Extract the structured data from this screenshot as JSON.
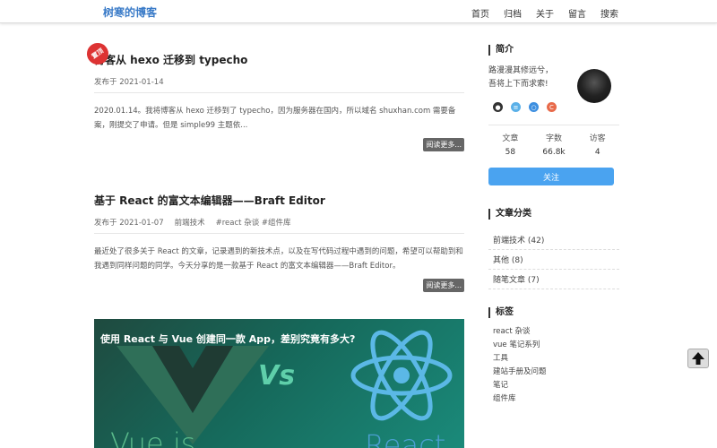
{
  "header": {
    "site_title": "树寒的博客",
    "nav": [
      "首页",
      "归档",
      "关于",
      "留言",
      "搜索"
    ]
  },
  "posts": [
    {
      "title": "博客从 hexo 迁移到 typecho",
      "badge": "置顶",
      "meta": "发布于 2021-01-14",
      "excerpt": "2020.01.14。我将博客从 hexo 迁移到了 typecho，因为服务器在国内，所以域名 shuxhan.com 需要备案，刚提交了申请。但是 simple99 主题依...",
      "read_more": "阅读更多..."
    },
    {
      "title": "基于 React 的富文本编辑器——Braft Editor",
      "meta_date": "发布于 2021-01-07",
      "meta_category": "前端技术",
      "meta_tags": "#react 杂谈  #组件库",
      "excerpt": "最近处了很多关于 React 的文章，记录遇到的新技术点，以及在写代码过程中遇到的问题，希望可以帮助到和我遇到同样问题的同学。今天分享的是一款基于 React 的富文本编辑器——Braft Editor。",
      "read_more": "阅读更多..."
    }
  ],
  "banner": {
    "title": "使用 React 与 Vue 创建同一款 App，差别究竟有多大?",
    "vs": "Vs",
    "left_word": "Vue.js",
    "right_word": "React"
  },
  "sidebar": {
    "intro": {
      "heading": "简介",
      "line1": "路漫漫其修远兮，",
      "line2": "吾将上下而求索!",
      "social_icons": [
        "github-icon",
        "bookmark-icon",
        "globe-icon",
        "c-icon"
      ],
      "social_colors": [
        "#333333",
        "#5ab0e8",
        "#3d8fe0",
        "#e86a4a"
      ]
    },
    "stats": [
      {
        "label": "文章",
        "value": "58"
      },
      {
        "label": "字数",
        "value": "66.8k"
      },
      {
        "label": "访客",
        "value": "4"
      }
    ],
    "follow_label": "关注",
    "categories": {
      "heading": "文章分类",
      "items": [
        "前端技术 (42)",
        "其他 (8)",
        "随笔文章 (7)"
      ]
    },
    "tags": {
      "heading": "标签",
      "items": [
        "react 杂谈",
        "vue 笔记系列",
        "工具",
        "建站手册及问题",
        "笔记",
        "组件库"
      ]
    }
  }
}
